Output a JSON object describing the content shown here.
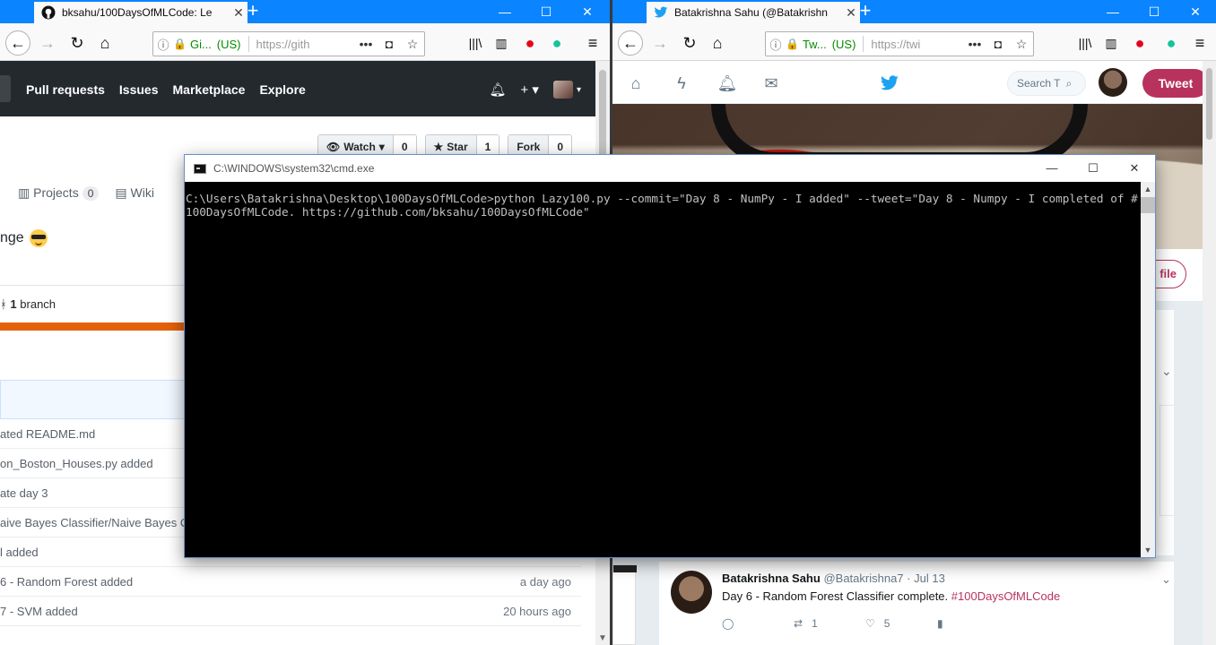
{
  "left_window": {
    "tab_title": "bksahu/100DaysOfMLCode: Le",
    "url_org": "Gi...",
    "url_country": "(US)",
    "url_text": "https://gith",
    "page_actions": "•••"
  },
  "right_window": {
    "tab_title": "Batakrishna Sahu (@Batakrishn",
    "url_org": "Tw...",
    "url_country": "(US)",
    "url_text": "https://twi",
    "page_actions": "•••"
  },
  "github": {
    "nav": [
      "Pull requests",
      "Issues",
      "Marketplace",
      "Explore"
    ],
    "watch_label": "Watch",
    "watch_count": "0",
    "star_label": "Star",
    "star_count": "1",
    "fork_label": "Fork",
    "fork_count": "0",
    "projects_label": "Projects",
    "projects_count": "0",
    "wiki_label": "Wiki",
    "description_tail": "nge",
    "branch_count": "1",
    "branch_label": "branch",
    "files": [
      {
        "message": "ated README.md",
        "age": ""
      },
      {
        "message": "on_Boston_Houses.py added",
        "age": ""
      },
      {
        "message": "ate day 3",
        "age": ""
      },
      {
        "message": "aive Bayes Classifier/Naive Bayes C",
        "age": ""
      },
      {
        "message": "l added",
        "age": ""
      },
      {
        "message": "6 - Random Forest added",
        "age": "a day ago"
      },
      {
        "message": "7 - SVM added",
        "age": "20 hours ago"
      }
    ]
  },
  "twitter": {
    "search_placeholder": "Search T",
    "tweet_button": "Tweet",
    "profile_button_tail": "file",
    "tweet": {
      "name": "Batakrishna Sahu",
      "handle": "@Batakrishna7",
      "date": "Jul 13",
      "text": "Day 6 - Random Forest Classifier complete.",
      "hashtag": "#100DaysOfMLCode",
      "retweets": "1",
      "likes": "5"
    }
  },
  "cmd": {
    "title": "C:\\WINDOWS\\system32\\cmd.exe",
    "output": "C:\\Users\\Batakrishna\\Desktop\\100DaysOfMLCode>python Lazy100.py --commit=\"Day 8 - NumPy - I added\" --tweet=\"Day 8 - Numpy - I completed of #100DaysOfMLCode. https://github.com/bksahu/100DaysOfMLCode\""
  },
  "colors": {
    "firefox_tabstrip": "#0a84ff",
    "github_header": "#24292e",
    "twitter_accent": "#b7335e",
    "lang_bar": "#e36209"
  }
}
